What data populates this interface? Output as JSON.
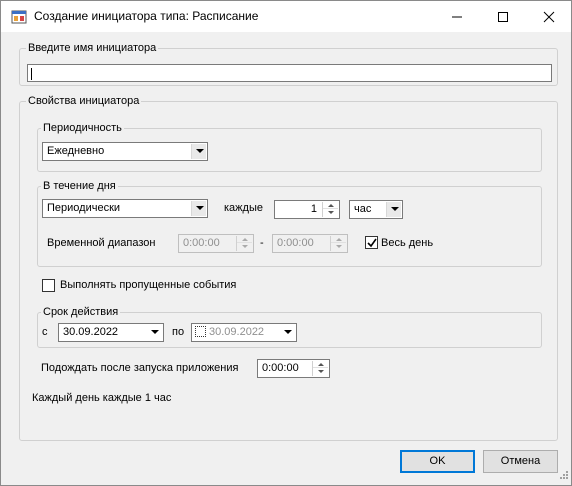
{
  "window": {
    "title": "Создание инициатора типа: Расписание",
    "icon": "app-window-icon",
    "controls": [
      "minimize-icon",
      "maximize-icon",
      "close-icon"
    ]
  },
  "name_group": {
    "label": "Введите имя инициатора",
    "value": ""
  },
  "props_group": {
    "label": "Свойства инициатора",
    "periodicity": {
      "label": "Периодичность",
      "selected": "Ежедневно"
    },
    "during_day": {
      "label": "В течение дня",
      "mode_selected": "Периодически",
      "every_label": "каждые",
      "every_value": "1",
      "unit_selected": "час",
      "range_label": "Временной диапазон",
      "range_from": "0:00:00",
      "range_sep": "-",
      "range_to": "0:00:00",
      "all_day_label": "Весь день",
      "all_day_checked": true
    },
    "missed_events": {
      "label": "Выполнять пропущенные события",
      "checked": false
    },
    "validity": {
      "label": "Срок действия",
      "from_label": "с",
      "from_value": "30.09.2022",
      "to_label": "по",
      "to_value": "30.09.2022",
      "to_checked": false
    },
    "wait": {
      "label": "Подождать после запуска приложения",
      "value": "0:00:00"
    },
    "summary": "Каждый день  каждые 1 час"
  },
  "buttons": {
    "ok": "OK",
    "cancel": "Отмена"
  }
}
